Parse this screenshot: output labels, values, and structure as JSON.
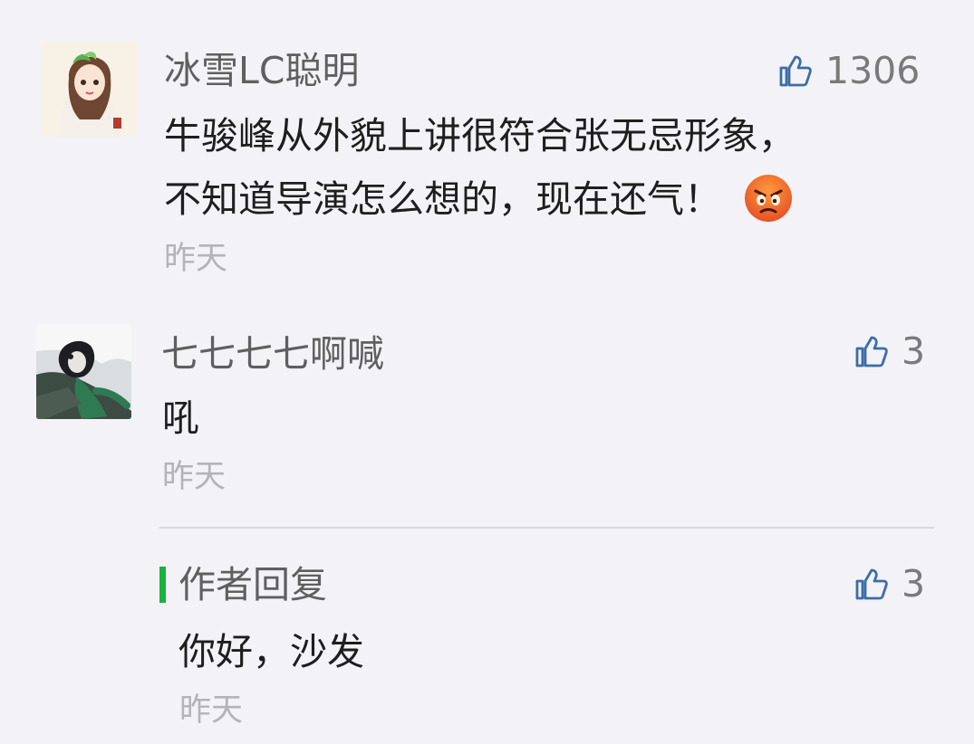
{
  "comments": [
    {
      "user": "冰雪LC聪明",
      "likes": "1306",
      "lines": [
        "牛骏峰从外貌上讲很符合张无忌形象，",
        "不知道导演怎么想的，现在还气！"
      ],
      "emoji": "angry-face-icon",
      "time": "昨天"
    },
    {
      "user": "七七七七啊喊",
      "likes": "3",
      "lines": [
        "吼"
      ],
      "time": "昨天",
      "reply": {
        "label": "作者回复",
        "likes": "3",
        "text": "你好，沙发",
        "time": "昨天"
      }
    }
  ],
  "colors": {
    "background": "#f3f2f6",
    "username": "#5f5f5f",
    "content": "#1e1e1e",
    "time": "#b4b4b8",
    "like_icon": "#3b6da8",
    "author_accent": "#17b33a"
  },
  "icons": {
    "like": "thumbs-up-icon",
    "emoji": "angry-face-icon"
  }
}
